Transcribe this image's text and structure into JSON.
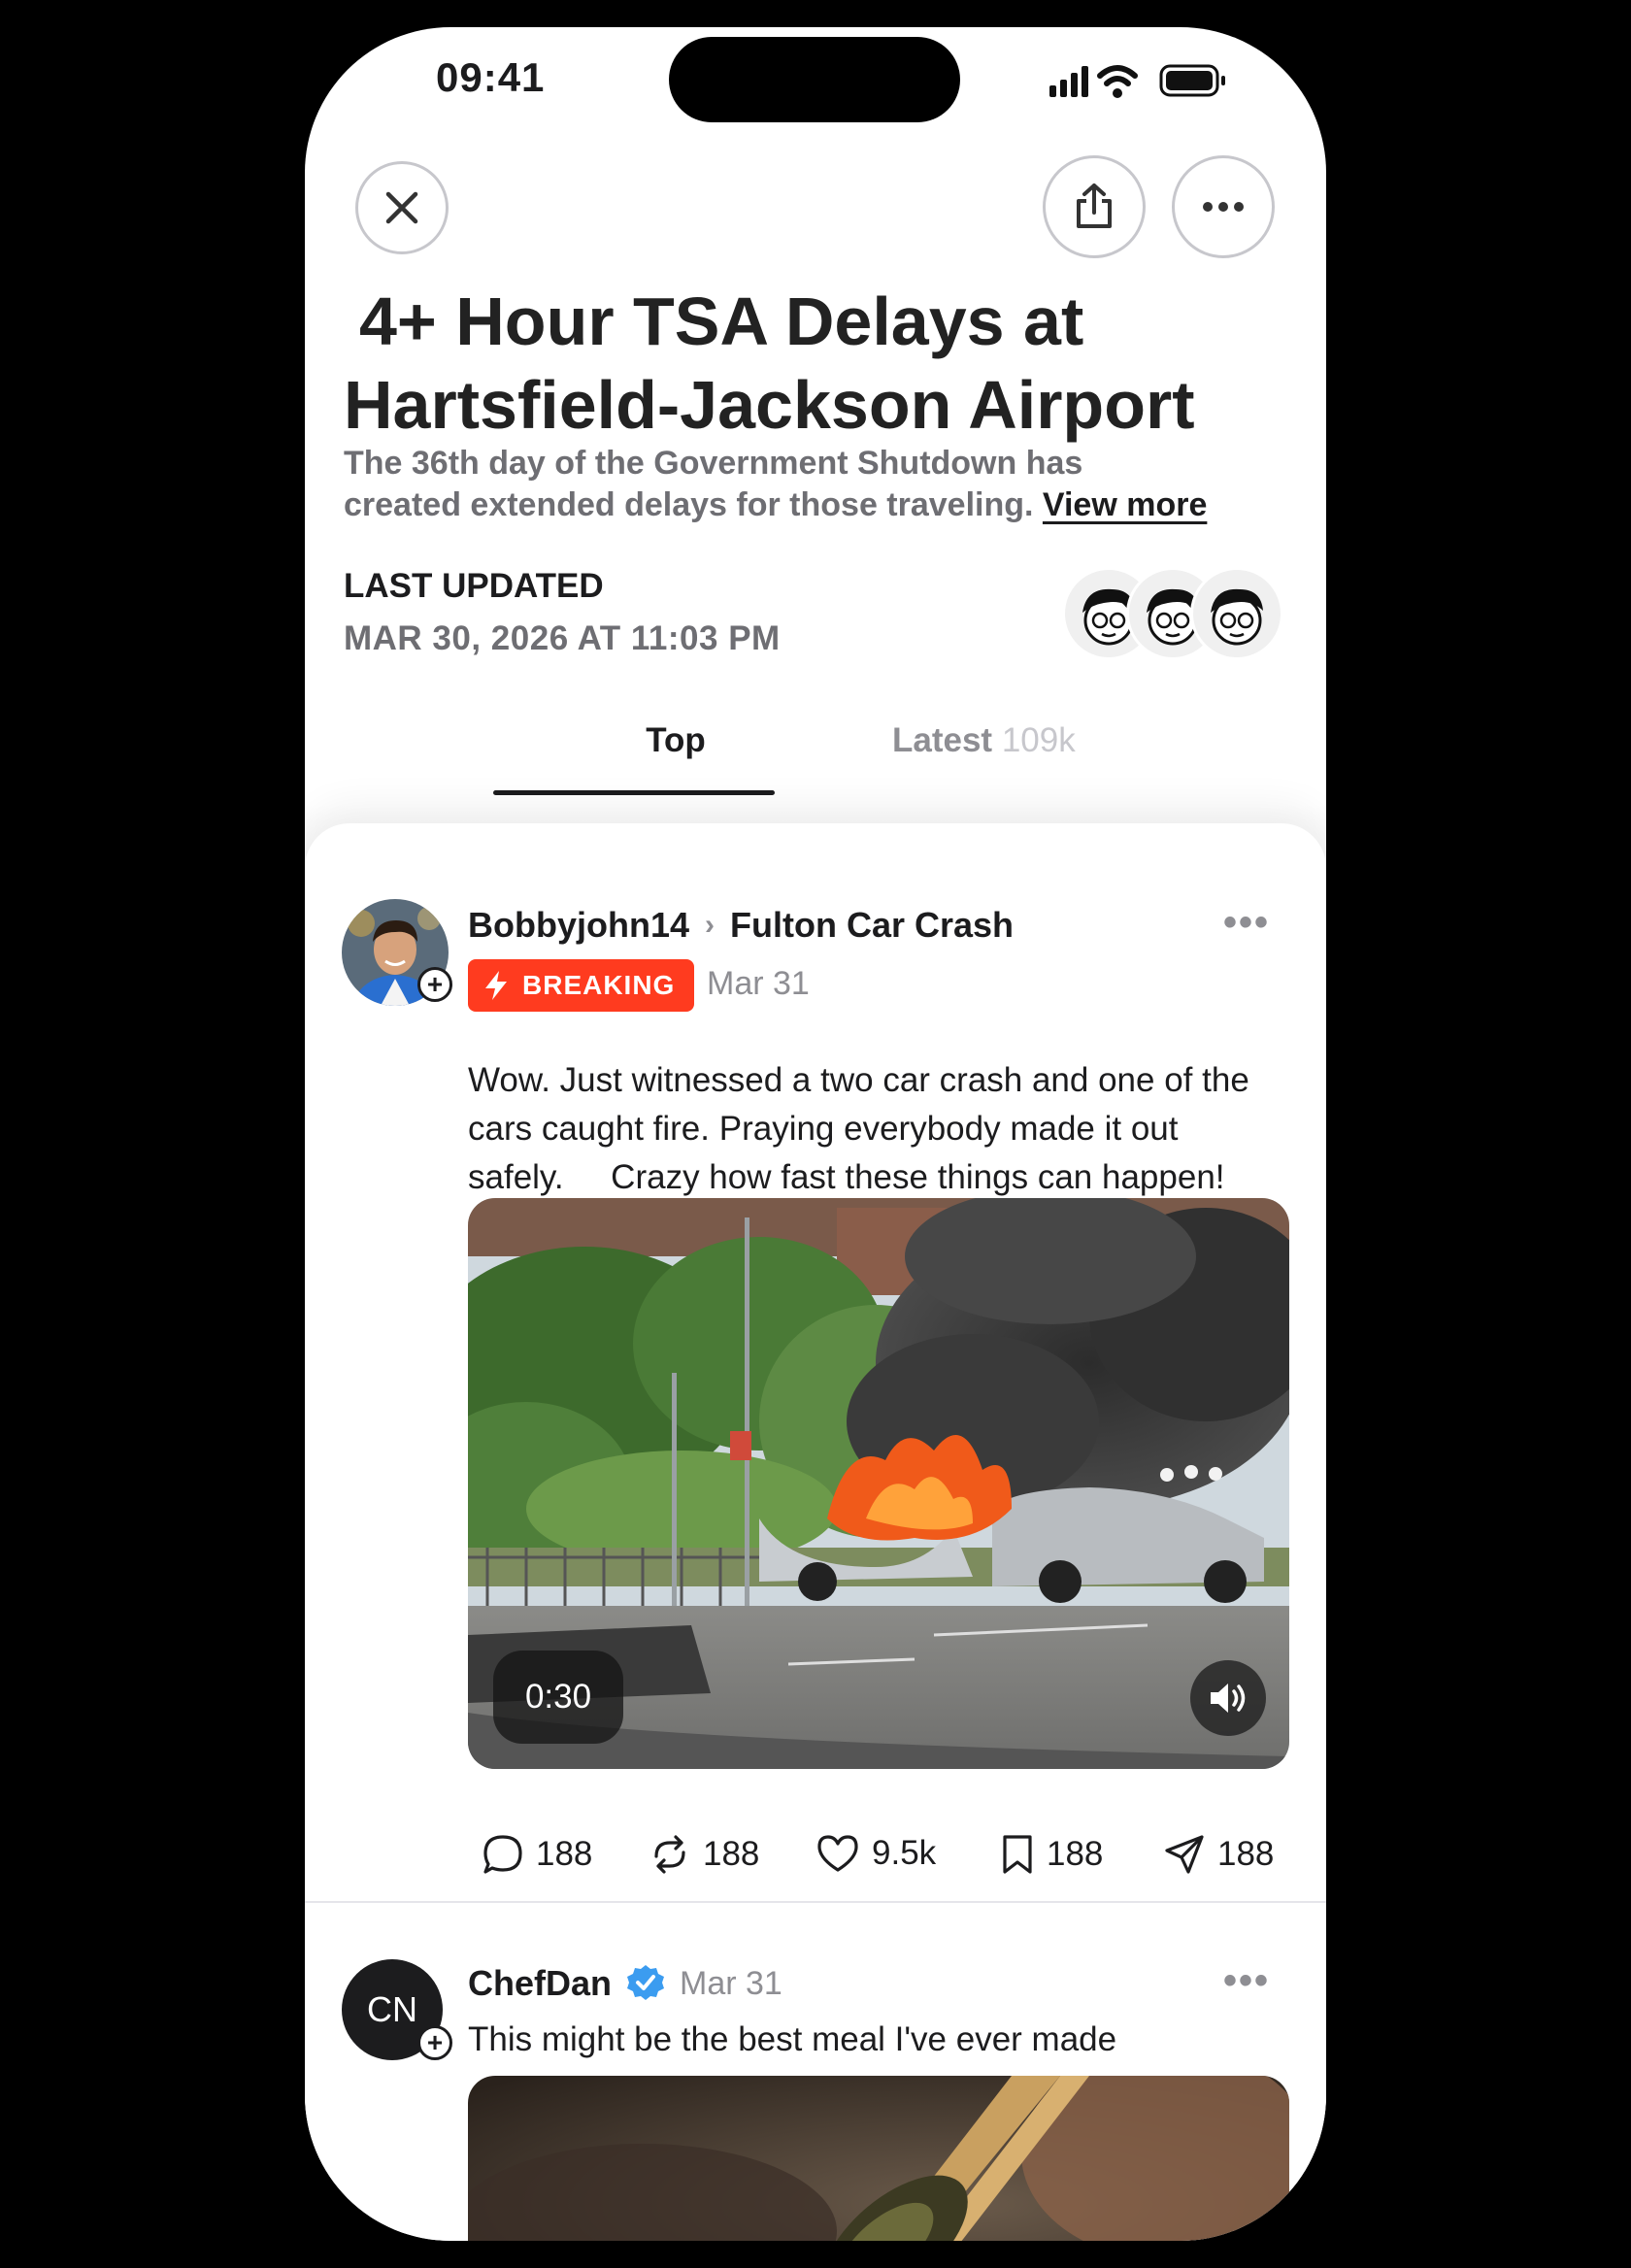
{
  "status_bar": {
    "time": "09:41"
  },
  "icons": {
    "close": "close-icon",
    "share": "share-icon",
    "more": "more-icon",
    "signal": "signal-icon",
    "wifi": "wifi-icon",
    "battery": "battery-icon"
  },
  "article": {
    "title_line1": "4+ Hour TSA Delays at",
    "title_line2": "Hartsfield-Jackson Airport",
    "subtitle_line1": "The 36th day of the Government Shutdown has",
    "subtitle_line2": "created extended delays for those traveling.",
    "view_more": "View more",
    "last_updated_label": "LAST UPDATED",
    "last_updated_value": "MAR 30, 2026 AT 11:03 PM"
  },
  "tabs": [
    {
      "label": "Top",
      "active": true
    },
    {
      "label": "Latest",
      "count": "109k",
      "active": false
    }
  ],
  "posts": [
    {
      "author": "Bobbyjohn14",
      "community": "Fulton Car Crash",
      "badge": "BREAKING",
      "date": "Mar 31",
      "text_line1": "Wow. Just witnessed a two car crash and one of the",
      "text_line2": "cars caught fire. Praying everybody made it out",
      "text_line3": "safely.     Crazy how fast these things can happen!",
      "video_duration": "0:30",
      "actions": {
        "comments": "188",
        "reposts": "188",
        "likes": "9.5k",
        "saves": "188",
        "shares": "188"
      }
    },
    {
      "author": "ChefDan",
      "avatar_initials": "CN",
      "verified": true,
      "date": "Mar 31",
      "text": "This might be the best meal I've ever made"
    }
  ],
  "colors": {
    "breaking": "#ff3b1f",
    "verified": "#3b9cf0",
    "text": "#1c1c1e",
    "muted": "#8e8e93"
  }
}
